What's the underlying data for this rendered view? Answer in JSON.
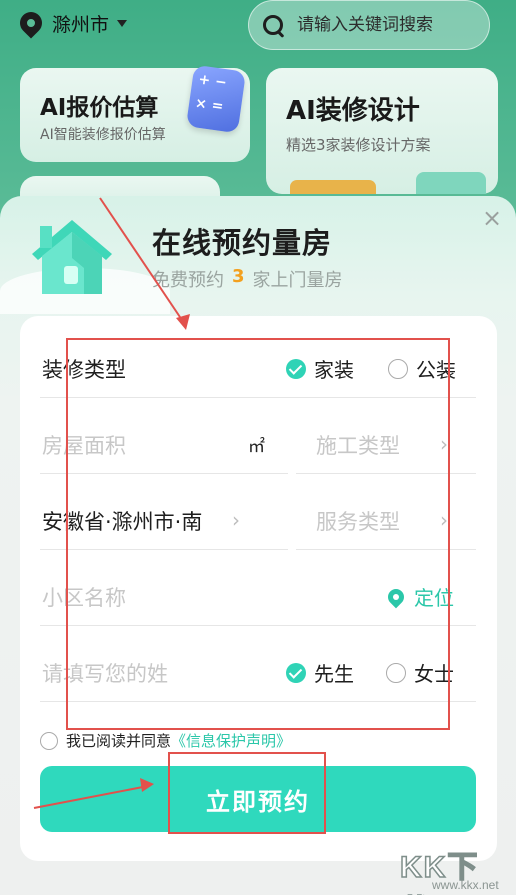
{
  "topbar": {
    "city": "滁州市",
    "search_placeholder": "请输入关键词搜索"
  },
  "cards": [
    {
      "title": "AI报价估算",
      "subtitle": "AI智能装修报价估算"
    },
    {
      "title": "AI装修设计",
      "subtitle": "精选3家装修设计方案"
    }
  ],
  "modal": {
    "title": "在线预约量房",
    "subtitle_prefix": "免费预约",
    "subtitle_count": "3",
    "subtitle_suffix": "家上门量房",
    "close_symbol": "×"
  },
  "form": {
    "decoration_type_label": "装修类型",
    "decoration_options": [
      {
        "label": "家装",
        "selected": true
      },
      {
        "label": "公装",
        "selected": false
      }
    ],
    "area_placeholder": "房屋面积",
    "area_unit": "㎡",
    "construction_placeholder": "施工类型",
    "region_value": "安徽省·滁州市·南",
    "service_placeholder": "服务类型",
    "community_placeholder": "小区名称",
    "locate_label": "定位",
    "surname_placeholder": "请填写您的姓",
    "gender_options": [
      {
        "label": "先生",
        "selected": true
      },
      {
        "label": "女士",
        "selected": false
      }
    ],
    "agree_text": "我已阅读并同意",
    "agree_link": "《信息保护声明》",
    "submit_label": "立即预约"
  },
  "watermark": {
    "brand": "KK下载",
    "url": "www.kkx.net"
  },
  "colors": {
    "accent": "#2fd9bd",
    "highlight_number": "#f3a01f",
    "annotation": "#e2514c"
  }
}
